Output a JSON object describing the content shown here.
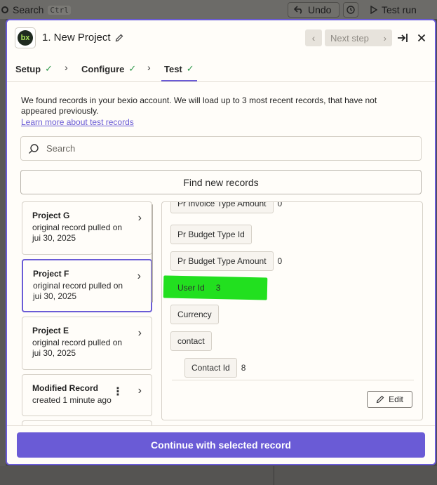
{
  "background": {
    "search_label": "Search",
    "search_shortcut": "Ctrl",
    "undo_label": "Undo",
    "test_run_label": "Test run"
  },
  "header": {
    "step_title": "1. New Project",
    "logo_text": "bx",
    "next_step_label": "Next step"
  },
  "tabs": [
    {
      "label": "Setup"
    },
    {
      "label": "Configure"
    },
    {
      "label": "Test"
    }
  ],
  "info": {
    "text": "We found records in your bexio account. We will load up to 3 most recent records, that have not appeared previously.",
    "link": "Learn more about test records"
  },
  "search": {
    "placeholder": "Search"
  },
  "find_button": "Find new records",
  "records": [
    {
      "title": "Project G",
      "line1": "original record pulled on",
      "line2": "jui 30, 2025"
    },
    {
      "title": "Project F",
      "line1": "original record pulled on",
      "line2": "jui 30, 2025"
    },
    {
      "title": "Project E",
      "line1": "original record pulled on",
      "line2": "jui 30, 2025"
    },
    {
      "title": "Modified Record",
      "line1": "created 1 minute ago"
    }
  ],
  "fields": [
    {
      "label": "Pr Invoice Type Amount",
      "value": "0"
    },
    {
      "label": "Pr Budget Type Id",
      "value": ""
    },
    {
      "label": "Pr Budget Type Amount",
      "value": "0"
    },
    {
      "label": "User Id",
      "value": "3"
    },
    {
      "label": "Currency",
      "value": ""
    },
    {
      "label": "contact",
      "value": ""
    },
    {
      "label": "Contact Id",
      "value": "8"
    }
  ],
  "edit_button": "Edit",
  "continue_button": "Continue with selected record",
  "colors": {
    "accent": "#6a5bd6",
    "success": "#2f9a4c",
    "highlight": "#22e01f"
  }
}
